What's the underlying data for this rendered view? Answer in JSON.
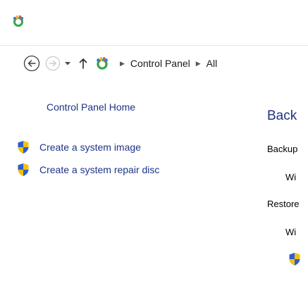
{
  "window": {
    "title_icon": "control-panel-icon"
  },
  "nav": {
    "back_icon": "back-arrow-icon",
    "forward_icon": "forward-arrow-icon",
    "recent_icon": "chevron-down-icon",
    "up_icon": "up-arrow-icon",
    "breadcrumb": [
      "Control Panel",
      "All "
    ]
  },
  "sidebar": {
    "home_label": "Control Panel Home",
    "tasks": [
      {
        "label": "Create a system image",
        "icon": "uac-shield-icon"
      },
      {
        "label": "Create a system repair disc",
        "icon": "uac-shield-icon"
      }
    ]
  },
  "main": {
    "heading": "Back",
    "sections": [
      {
        "label": "Backup",
        "text": "Wi"
      },
      {
        "label": "Restore",
        "text": "Wi"
      }
    ]
  },
  "colors": {
    "link": "#1e3287",
    "shield_blue": "#2d5fc9",
    "shield_yellow": "#f4c20d"
  }
}
